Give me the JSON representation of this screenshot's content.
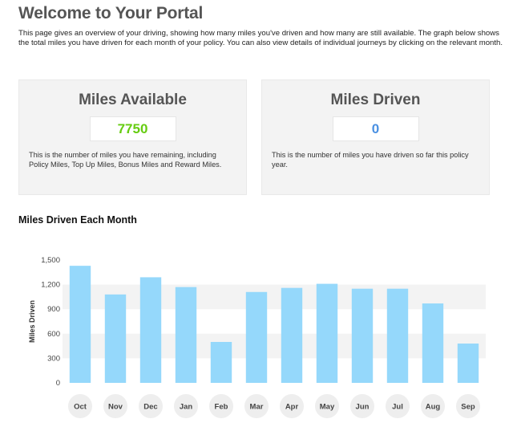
{
  "page": {
    "title": "Welcome to Your Portal",
    "intro": "This page gives an overview of your driving, showing how many miles you've driven and how many are still available. The graph below shows the total miles you have driven for each month of your policy. You can also view details of individual journeys by clicking on the relevant month."
  },
  "cards": {
    "available": {
      "title": "Miles Available",
      "value": "7750",
      "value_color": "#66cc11",
      "description": "This is the number of miles you have remaining, including Policy Miles, Top Up Miles, Bonus Miles and Reward Miles."
    },
    "driven": {
      "title": "Miles Driven",
      "value": "0",
      "value_color": "#4a90e2",
      "description": "This is the number of miles you have driven so far this policy year."
    }
  },
  "chart_title": "Miles Driven Each Month",
  "colors": {
    "bar": "#95d8fb",
    "band": "#f3f3f3",
    "month_bubble": "#eeeeee"
  },
  "chart_data": {
    "type": "bar",
    "categories": [
      "Oct",
      "Nov",
      "Dec",
      "Jan",
      "Feb",
      "Mar",
      "Apr",
      "May",
      "Jun",
      "Jul",
      "Aug",
      "Sep"
    ],
    "values": [
      1430,
      1080,
      1290,
      1170,
      500,
      1110,
      1160,
      1210,
      1150,
      1150,
      970,
      480
    ],
    "ylabel": "Miles Driven",
    "ylim": [
      0,
      1500
    ],
    "yticks": [
      "0",
      "300",
      "600",
      "900",
      "1,200",
      "1,500"
    ],
    "grid": "alternating bands",
    "months_clickable": true
  }
}
